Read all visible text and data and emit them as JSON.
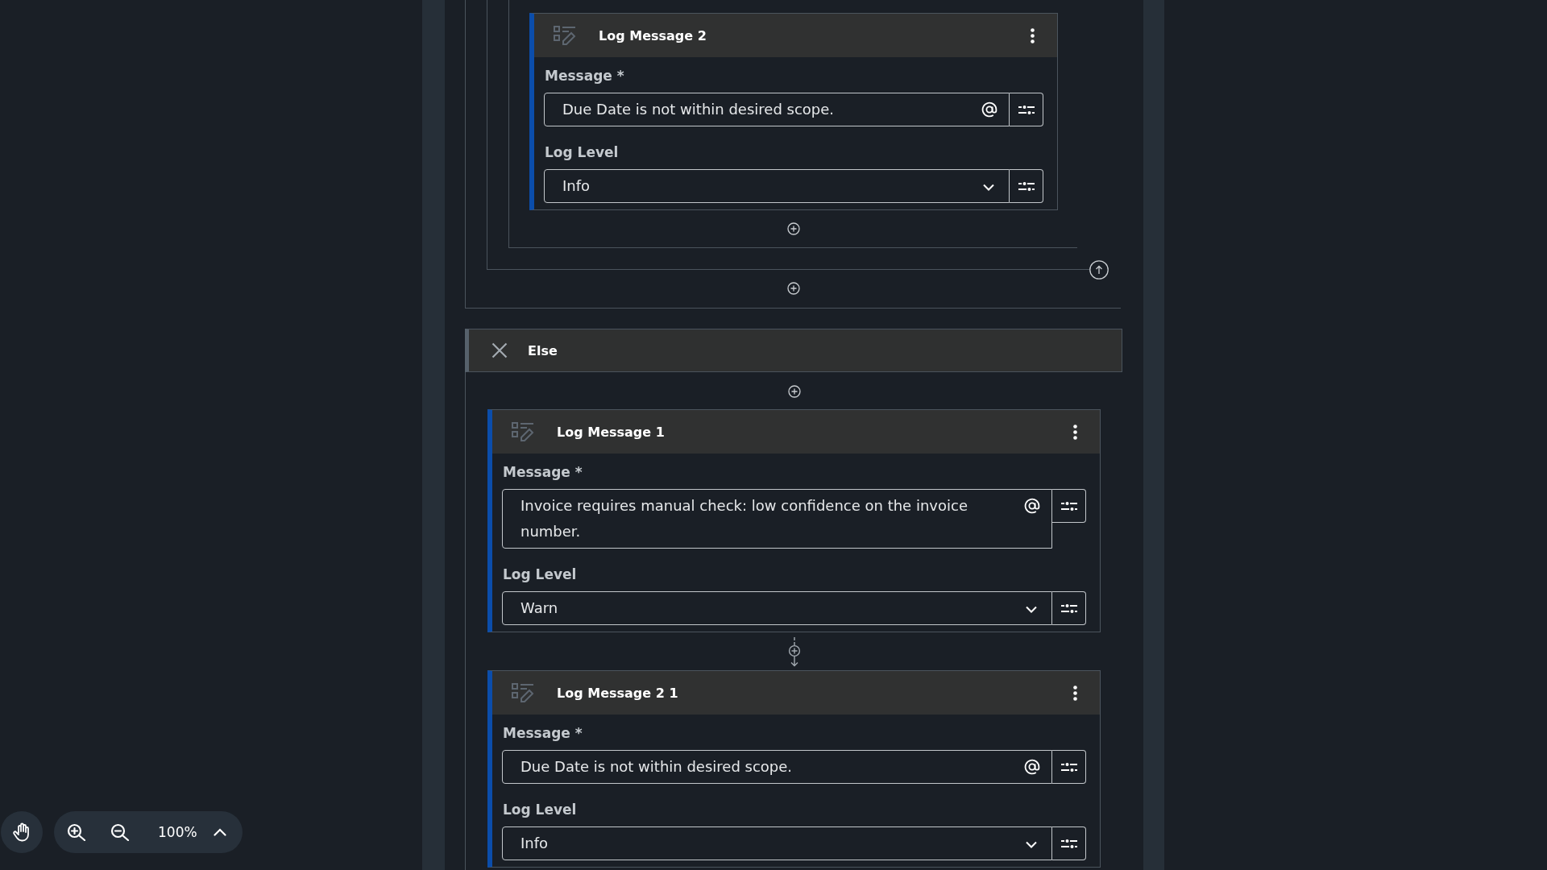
{
  "nested_scope": {
    "steps": [
      {
        "title": "Log Message 2",
        "fields": [
          {
            "kind": "text",
            "label": "Message *",
            "value": "Due Date is not within desired scope."
          },
          {
            "kind": "select",
            "label": "Log Level",
            "value": "Info"
          }
        ]
      }
    ]
  },
  "else_branch": {
    "title": "Else",
    "steps": [
      {
        "title": "Log Message 1",
        "fields": [
          {
            "kind": "text",
            "label": "Message *",
            "value": "Invoice requires manual check: low confidence on the invoice number."
          },
          {
            "kind": "select",
            "label": "Log Level",
            "value": "Warn"
          }
        ]
      },
      {
        "title": "Log Message 2 1",
        "fields": [
          {
            "kind": "text",
            "label": "Message *",
            "value": "Due Date is not within desired scope."
          },
          {
            "kind": "select",
            "label": "Log Level",
            "value": "Info"
          }
        ]
      }
    ]
  },
  "zoom_controls": {
    "zoom_level": "100%"
  }
}
